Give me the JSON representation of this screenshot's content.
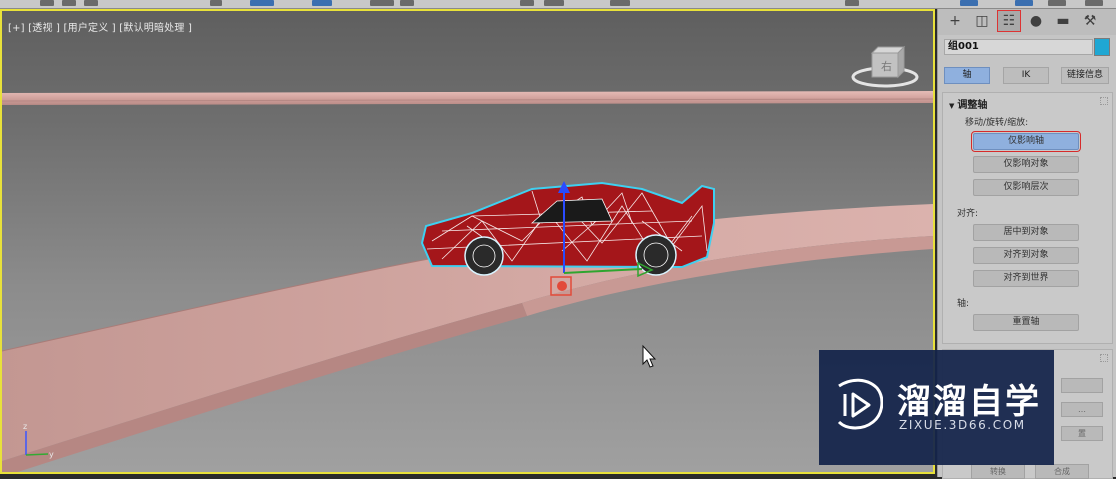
{
  "viewport": {
    "label": "[+] [透视 ] [用户定义 ] [默认明暗处理 ]",
    "viewcube_face": "右",
    "axis_z": "z",
    "axis_y": "y"
  },
  "command_panel": {
    "tabs": [
      {
        "icon": "create-plus-icon",
        "glyph": "+"
      },
      {
        "icon": "modify-icon",
        "glyph": "◫"
      },
      {
        "icon": "hierarchy-icon",
        "glyph": "☷"
      },
      {
        "icon": "motion-icon",
        "glyph": "●"
      },
      {
        "icon": "display-icon",
        "glyph": "▬"
      },
      {
        "icon": "utilities-wrench-icon",
        "glyph": "🔧"
      }
    ],
    "object_name": "组001",
    "object_color": "#1fa7d3",
    "sub_tabs": [
      "轴",
      "IK",
      "链接信息"
    ],
    "adjust_pivot": {
      "title": "调整轴",
      "move_rotate_scale_label": "移动/旋转/缩放:",
      "affect_pivot_only": "仅影响轴",
      "affect_object_only": "仅影响对象",
      "affect_hierarchy_only": "仅影响层次",
      "alignment_label": "对齐:",
      "center_to_object": "居中到对象",
      "align_to_object": "对齐到对象",
      "align_to_world": "对齐到世界",
      "pivot_label": "轴:",
      "reset_pivot": "重置轴"
    },
    "lower_rollout": {
      "partial_label_1": "置",
      "bottom_left": "转换",
      "bottom_right": "合成"
    }
  },
  "watermark": {
    "title": "溜溜自学",
    "subtitle": "ZIXUE.3D66.COM"
  },
  "colors": {
    "selection_border": "#e8e13a",
    "highlight_red": "#d62a2a",
    "active_blue": "#8fb0de",
    "car_red": "#a4161a",
    "track_pink": "#d8a9a4"
  }
}
